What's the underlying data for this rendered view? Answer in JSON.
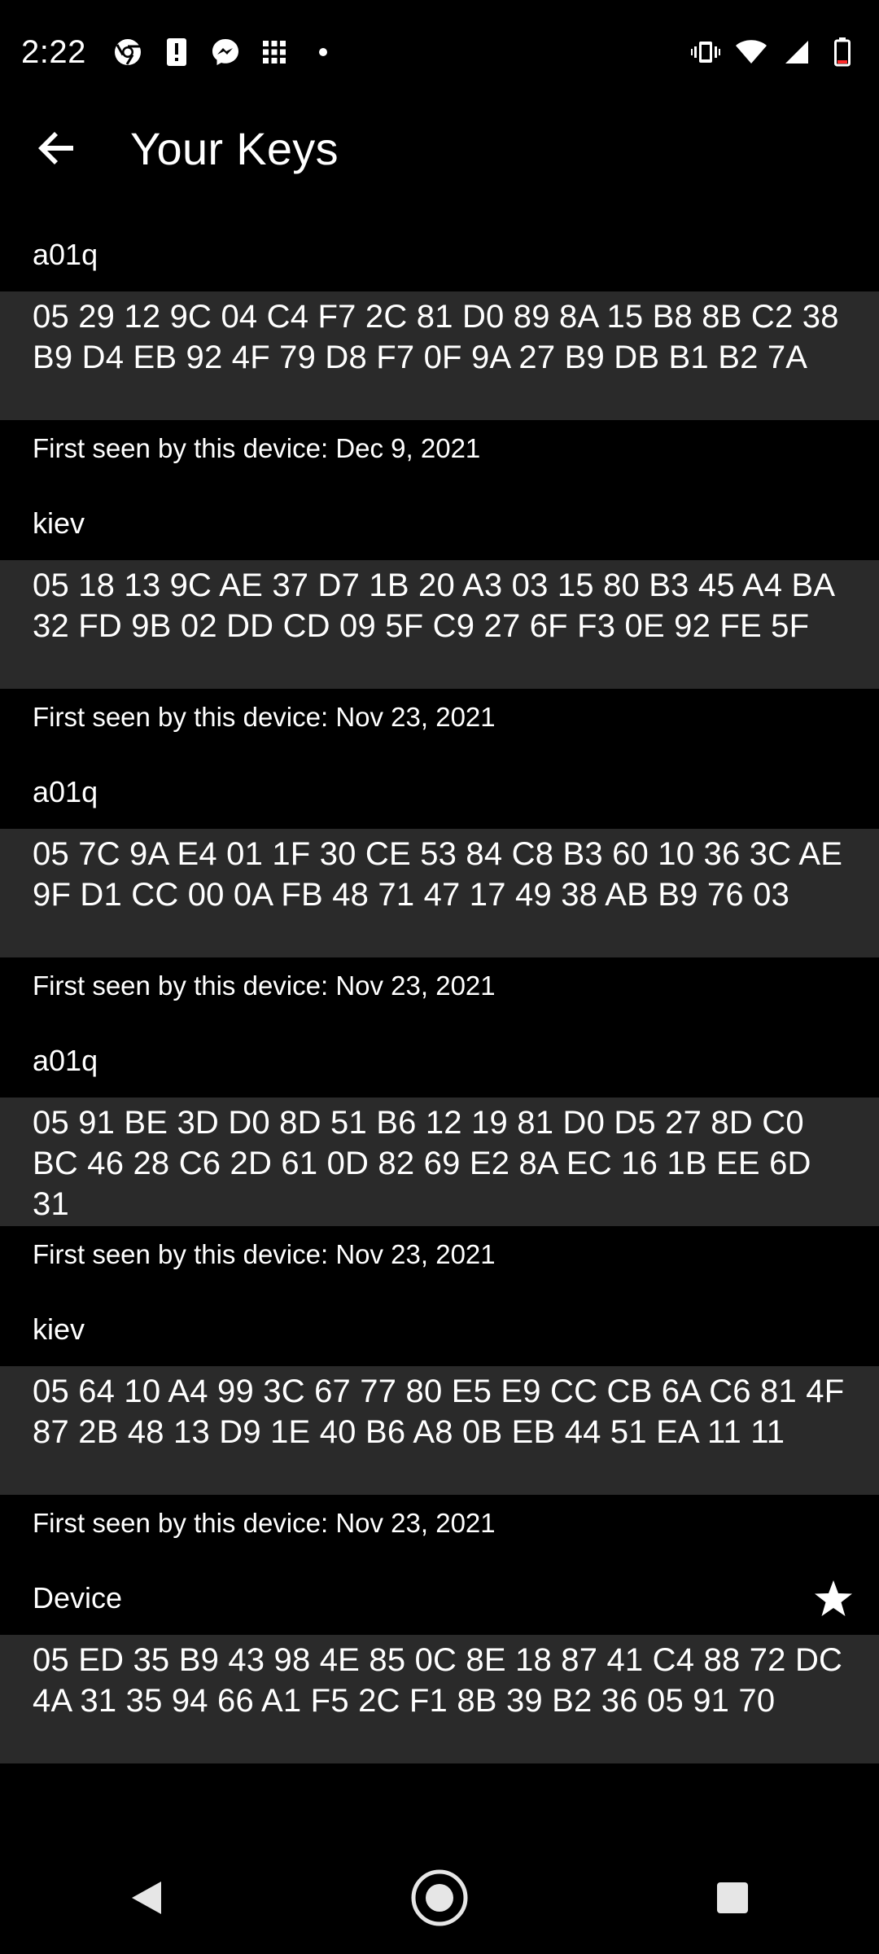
{
  "status_bar": {
    "time": "2:22",
    "left_icons": [
      "chrome-icon",
      "alert-icon",
      "messenger-icon",
      "app-grid-icon",
      "dot-icon"
    ],
    "right_icons": [
      "vibrate-icon",
      "wifi-icon",
      "signal-icon",
      "battery-icon"
    ]
  },
  "app_bar": {
    "title": "Your Keys"
  },
  "keys": [
    {
      "name": "a01q",
      "fingerprint": "05 29 12 9C 04 C4 F7 2C 81 D0 89 8A 15 B8 8B C2 38 B9 D4 EB 92 4F 79 D8 F7 0F 9A 27 B9 DB B1 B2 7A",
      "first_seen": "First seen by this device: Dec 9, 2021"
    },
    {
      "name": "kiev",
      "fingerprint": "05 18 13 9C AE 37 D7 1B 20 A3 03 15 80 B3 45 A4 BA 32 FD 9B 02 DD CD 09 5F C9 27 6F F3 0E 92 FE 5F",
      "first_seen": "First seen by this device: Nov 23, 2021"
    },
    {
      "name": "a01q",
      "fingerprint": "05 7C 9A E4 01 1F 30 CE 53 84 C8 B3 60 10 36 3C AE 9F D1 CC 00 0A FB 48 71 47 17 49 38 AB B9 76 03",
      "first_seen": "First seen by this device: Nov 23, 2021"
    },
    {
      "name": "a01q",
      "fingerprint": "05 91 BE 3D D0 8D 51 B6 12 19 81 D0 D5 27 8D C0 BC 46 28 C6 2D 61 0D 82 69 E2 8A EC 16 1B EE 6D 31",
      "first_seen": "First seen by this device: Nov 23, 2021"
    },
    {
      "name": "kiev",
      "fingerprint": "05 64 10 A4 99 3C 67 77 80 E5 E9 CC CB 6A C6 81 4F 87 2B 48 13 D9 1E 40 B6 A8 0B EB 44 51 EA 11 11",
      "first_seen": "First seen by this device: Nov 23, 2021"
    },
    {
      "name": "Device",
      "fingerprint": "05 ED 35 B9 43 98 4E 85 0C 8E 18 87 41 C4 88 72 DC 4A 31 35 94 66 A1 F5 2C F1 8B 39 B2 36 05 91 70",
      "first_seen": "",
      "starred": true
    }
  ],
  "nav_bar": {
    "icons": [
      "back-triangle-icon",
      "home-circle-icon",
      "recents-square-icon"
    ]
  },
  "colors": {
    "background": "#000000",
    "fingerprint_row": "#2a2a2a",
    "text": "#ffffff"
  }
}
